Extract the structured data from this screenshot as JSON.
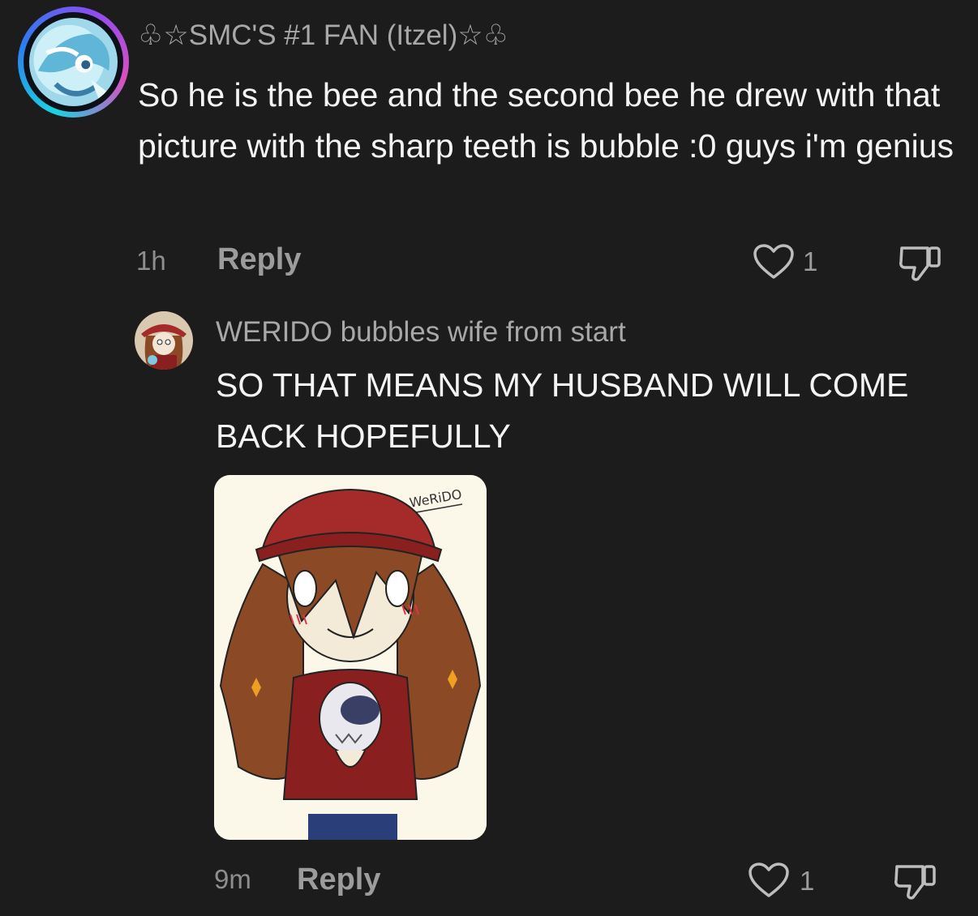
{
  "comments": [
    {
      "username": "♧☆SMC'S #1 FAN (Itzel)☆♧",
      "text": "So he is the bee and the second bee he drew with that picture with the sharp teeth is bubble :0 guys i'm genius",
      "time": "1h",
      "reply_label": "Reply",
      "likes": "1",
      "avatar_icon": "blue-character-avatar",
      "avatar_ring_colors": [
        "#1ad3e0",
        "#2b7cf0",
        "#8a4df0",
        "#d94fc2"
      ]
    },
    {
      "username": "WERIDO bubbles wife from start",
      "text": "SO THAT MEANS MY HUSBAND WILL COME BACK HOPEFULLY",
      "time": "9m",
      "reply_label": "Reply",
      "likes": "1",
      "avatar_icon": "red-hat-character-avatar",
      "attachment": {
        "description_icon": "drawn-character-image",
        "signature": "WeRiDO"
      }
    }
  ],
  "colors": {
    "background": "#1c1c1c",
    "text_primary": "#f4f4f4",
    "text_secondary": "#a8a8a8",
    "hat_red": "#a52a2a",
    "hair_brown": "#8b4a25"
  }
}
